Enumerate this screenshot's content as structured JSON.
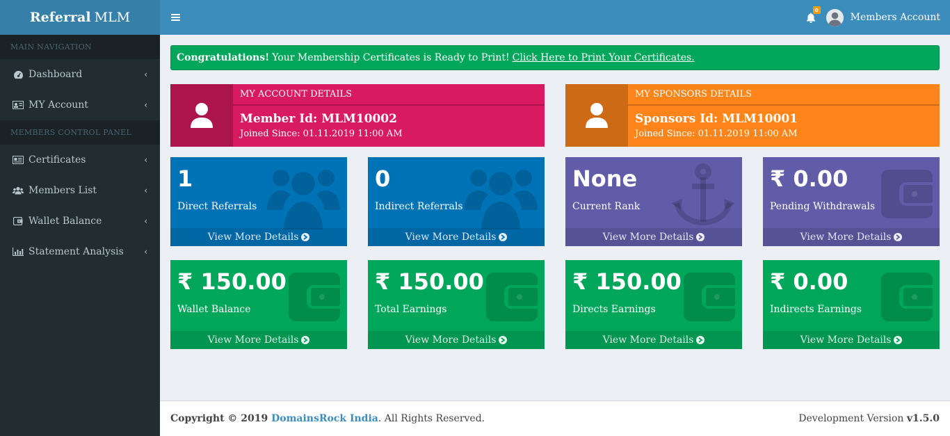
{
  "brand": {
    "bold": "Referral",
    "rest": "MLM"
  },
  "sidebar": {
    "header_main": "MAIN NAVIGATION",
    "header_members": "MEMBERS CONTROL PANEL",
    "items": [
      {
        "label": "Dashboard",
        "icon": "dashboard-icon"
      },
      {
        "label": "MY Account",
        "icon": "id-card-icon"
      },
      {
        "label": "Certificates",
        "icon": "certificate-icon"
      },
      {
        "label": "Members List",
        "icon": "users-icon"
      },
      {
        "label": "Wallet Balance",
        "icon": "wallet-icon"
      },
      {
        "label": "Statement Analysis",
        "icon": "bar-chart-icon"
      }
    ]
  },
  "header": {
    "notifications_count": "0",
    "account_name": "Members Account"
  },
  "alert": {
    "bold": "Congratulations!",
    "text": "Your Membership Certificates is Ready to Print!",
    "link": "Click Here to Print Your Certificates."
  },
  "account_details": {
    "title": "MY ACCOUNT DETAILS",
    "id_line": "Member Id: MLM10002",
    "joined": "Joined Since: 01.11.2019 11:00 AM"
  },
  "sponsor_details": {
    "title": "MY SPONSORS DETAILS",
    "id_line": "Sponsors Id: MLM10001",
    "joined": "Joined Since: 01.11.2019 11:00 AM"
  },
  "stats": [
    {
      "value": "1",
      "label": "Direct Referrals",
      "footer": "View More Details"
    },
    {
      "value": "0",
      "label": "Indirect Referrals",
      "footer": "View More Details"
    },
    {
      "value": "None",
      "label": "Current Rank",
      "footer": "View More Details"
    },
    {
      "value": "₹ 0.00",
      "label": "Pending Withdrawals",
      "footer": "View More Details"
    },
    {
      "value": "₹ 150.00",
      "label": "Wallet Balance",
      "footer": "View More Details"
    },
    {
      "value": "₹ 150.00",
      "label": "Total Earnings",
      "footer": "View More Details"
    },
    {
      "value": "₹ 150.00",
      "label": "Directs Earnings",
      "footer": "View More Details"
    },
    {
      "value": "₹ 0.00",
      "label": "Indirects Earnings",
      "footer": "View More Details"
    }
  ],
  "footer": {
    "copyright": "Copyright © 2019",
    "company": "DomainsRock India",
    "rights": ". All Rights Reserved.",
    "version_label": "Development Version",
    "version": "v1.5.0"
  },
  "colors": {
    "sidebar": "#222d32",
    "header": "#3c8dbc",
    "pink": "#d81b60",
    "orange": "#ff851b",
    "blue": "#0073b7",
    "purple": "#605ca8",
    "green": "#00a65a"
  }
}
